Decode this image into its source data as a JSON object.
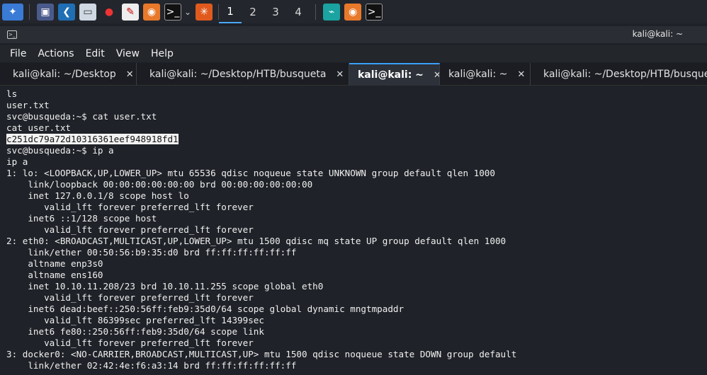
{
  "panel": {
    "icons": [
      "kali-menu-icon",
      "workspace-icon",
      "vscode-icon",
      "file-manager-icon",
      "cherrytree-icon",
      "text-editor-icon",
      "firefox-icon",
      "terminal-icon",
      "burpsuite-icon"
    ],
    "workspaces": [
      "1",
      "2",
      "3",
      "4"
    ],
    "extra_icons": [
      "network-icon",
      "firefox-icon",
      "terminal-icon"
    ]
  },
  "window": {
    "title": "kali@kali: ~"
  },
  "menu": [
    "File",
    "Actions",
    "Edit",
    "View",
    "Help"
  ],
  "tabs": [
    {
      "label": "kali@kali: ~/Desktop",
      "active": false
    },
    {
      "label": "kali@kali: ~/Desktop/HTB/busqueta",
      "active": false
    },
    {
      "label": "kali@kali: ~",
      "active": true
    },
    {
      "label": "kali@kali: ~",
      "active": false
    },
    {
      "label": "kali@kali: ~/Desktop/HTB/busqueta",
      "active": false
    }
  ],
  "terminal": {
    "lines": [
      "ls",
      "user.txt",
      "svc@busqueda:~$ cat user.txt",
      "cat user.txt",
      "c251dc79a72d10316361eef948918fd1",
      "svc@busqueda:~$ ip a",
      "ip a",
      "1: lo: <LOOPBACK,UP,LOWER_UP> mtu 65536 qdisc noqueue state UNKNOWN group default qlen 1000",
      "    link/loopback 00:00:00:00:00:00 brd 00:00:00:00:00:00",
      "    inet 127.0.0.1/8 scope host lo",
      "       valid_lft forever preferred_lft forever",
      "    inet6 ::1/128 scope host",
      "       valid_lft forever preferred_lft forever",
      "2: eth0: <BROADCAST,MULTICAST,UP,LOWER_UP> mtu 1500 qdisc mq state UP group default qlen 1000",
      "    link/ether 00:50:56:b9:35:d0 brd ff:ff:ff:ff:ff:ff",
      "    altname enp3s0",
      "    altname ens160",
      "    inet 10.10.11.208/23 brd 10.10.11.255 scope global eth0",
      "       valid_lft forever preferred_lft forever",
      "    inet6 dead:beef::250:56ff:feb9:35d0/64 scope global dynamic mngtmpaddr",
      "       valid_lft 86399sec preferred_lft 14399sec",
      "    inet6 fe80::250:56ff:feb9:35d0/64 scope link",
      "       valid_lft forever preferred_lft forever",
      "3: docker0: <NO-CARRIER,BROADCAST,MULTICAST,UP> mtu 1500 qdisc noqueue state DOWN group default",
      "    link/ether 02:42:4e:f6:a3:14 brd ff:ff:ff:ff:ff:ff"
    ],
    "highlight_index": 4
  }
}
